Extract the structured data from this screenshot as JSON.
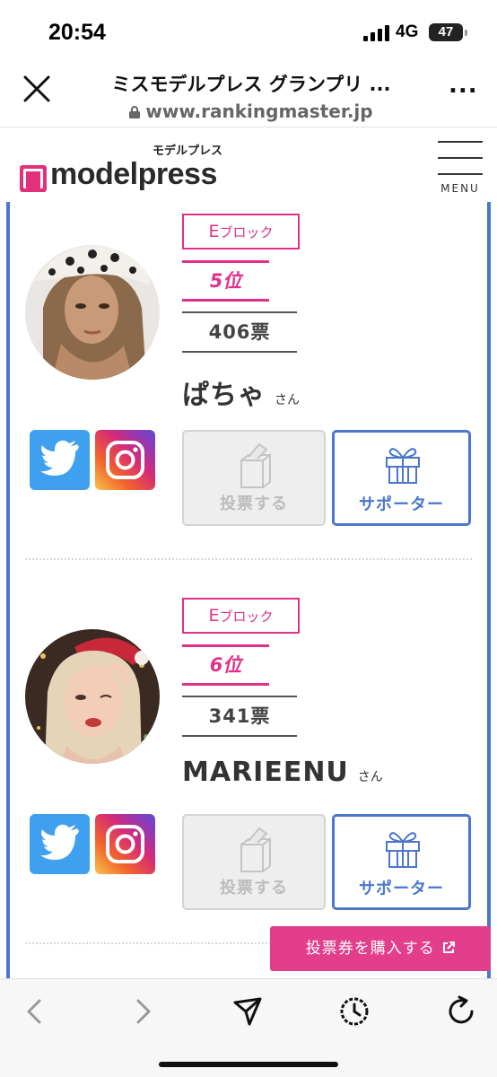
{
  "status": {
    "time": "20:54",
    "network": "4G",
    "battery": "47"
  },
  "browser": {
    "title": "ミスモデルプレス グランプリ ...",
    "url": "www.rankingmaster.jp",
    "more": "..."
  },
  "site": {
    "logo_small": "モデルプレス",
    "logo_word": "modelpress",
    "menu_label": "MENU"
  },
  "entries": [
    {
      "block_letter": "E",
      "block_suffix": "ブロック",
      "rank": "5位",
      "votes": "406票",
      "name": "ぱちゃ",
      "honorific": "さん",
      "vote_label": "投票する",
      "supporter_label": "サポーター"
    },
    {
      "block_letter": "E",
      "block_suffix": "ブロック",
      "rank": "6位",
      "votes": "341票",
      "name": "MARIEENU",
      "honorific": "さん",
      "vote_label": "投票する",
      "supporter_label": "サポーター"
    }
  ],
  "buy_ticket": {
    "label": "投票券を購入する"
  },
  "colors": {
    "accent_pink": "#e0318a",
    "accent_blue": "#4a77cd",
    "twitter": "#3fa0ef"
  },
  "icons": [
    "close-icon",
    "lock-icon",
    "more-icon",
    "twitter-icon",
    "instagram-icon",
    "ballot-box-icon",
    "gift-icon",
    "external-link-icon",
    "back-icon",
    "forward-icon",
    "share-icon",
    "history-icon",
    "reload-icon"
  ]
}
